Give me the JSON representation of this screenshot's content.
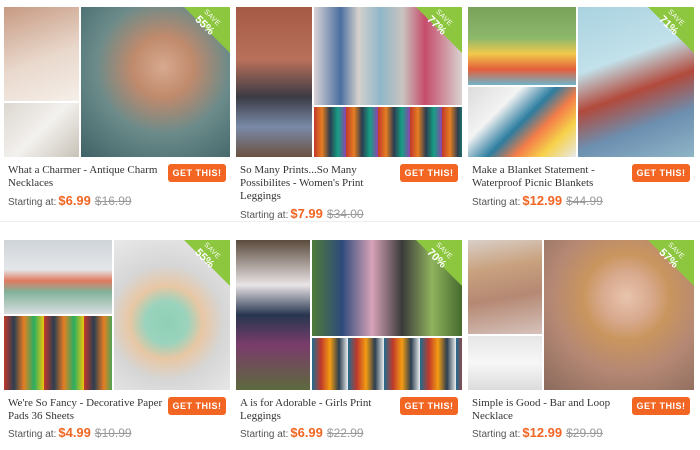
{
  "products": [
    {
      "title": "What a Charmer - Antique Charm Necklaces",
      "starting_label": "Starting at:",
      "price": "$6.99",
      "original_price": "$16.99",
      "save_label": "SAVE",
      "save_pct": "55%",
      "button": "GET THIS!"
    },
    {
      "title": "So Many Prints...So Many Possibilites - Women's Print Leggings",
      "starting_label": "Starting at:",
      "price": "$7.99",
      "original_price": "$34.00",
      "save_label": "SAVE",
      "save_pct": "77%",
      "button": "GET THIS!"
    },
    {
      "title": "Make a Blanket Statement - Waterproof Picnic Blankets",
      "starting_label": "Starting at:",
      "price": "$12.99",
      "original_price": "$44.99",
      "save_label": "SAVE",
      "save_pct": "71%",
      "button": "GET THIS!"
    },
    {
      "title": "We're So Fancy - Decorative Paper Pads 36 Sheets",
      "starting_label": "Starting at:",
      "price": "$4.99",
      "original_price": "$10.99",
      "save_label": "SAVE",
      "save_pct": "55%",
      "button": "GET THIS!"
    },
    {
      "title": "A is for Adorable - Girls Print Leggings",
      "starting_label": "Starting at:",
      "price": "$6.99",
      "original_price": "$22.99",
      "save_label": "SAVE",
      "save_pct": "70%",
      "button": "GET THIS!"
    },
    {
      "title": "Simple is Good - Bar and Loop Necklace",
      "starting_label": "Starting at:",
      "price": "$12.99",
      "original_price": "$29.99",
      "save_label": "SAVE",
      "save_pct": "57%",
      "button": "GET THIS!"
    }
  ],
  "colors": {
    "accent": "#f26522",
    "save_badge": "#8dc63f"
  }
}
